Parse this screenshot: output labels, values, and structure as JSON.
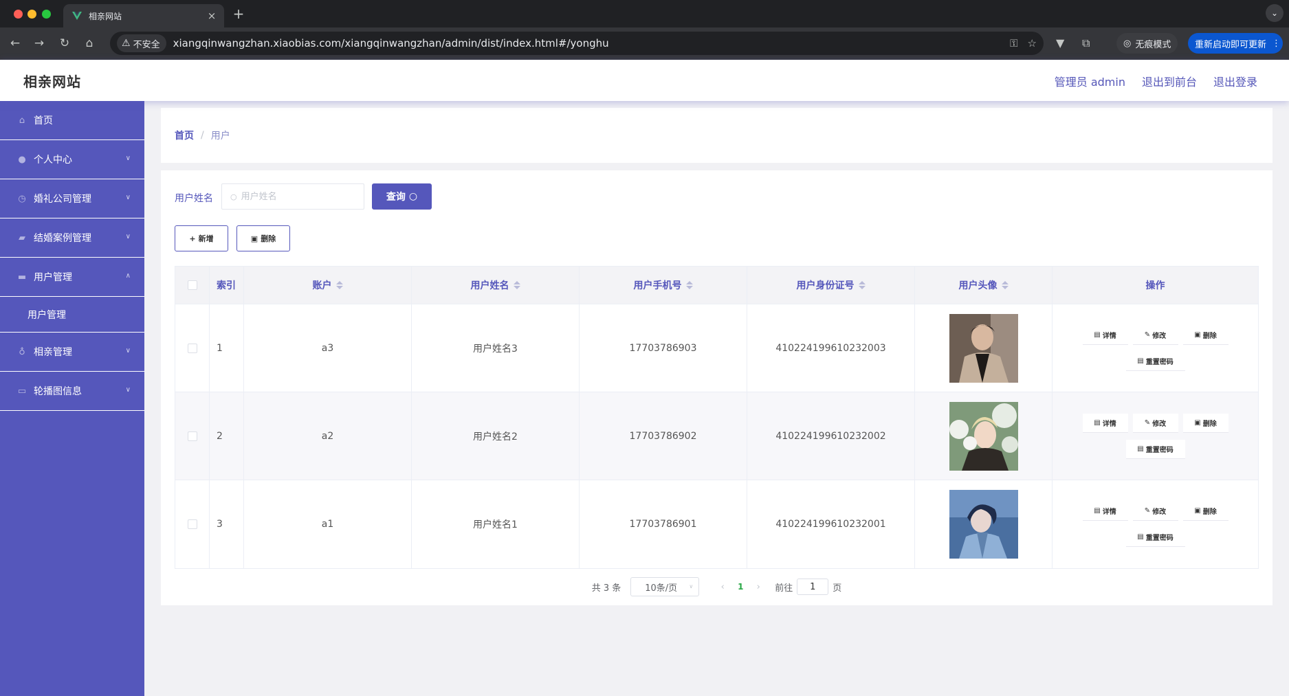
{
  "browser": {
    "tab_title": "相亲网站",
    "tab_close": "×",
    "new_tab": "+",
    "insecure_label": "不安全",
    "url": "xiangqinwangzhan.xiaobias.com/xiangqinwangzhan/admin/dist/index.html#/yonghu",
    "incognito_label": "无痕模式",
    "update_label": "重新启动即可更新"
  },
  "header": {
    "title": "相亲网站",
    "admin_label": "管理员 admin",
    "frontend_link": "退出到前台",
    "logout_link": "退出登录"
  },
  "sidebar": {
    "items": [
      {
        "label": "首页",
        "icon": "home-icon"
      },
      {
        "label": "个人中心",
        "icon": "user-icon"
      },
      {
        "label": "婚礼公司管理",
        "icon": "clock-icon"
      },
      {
        "label": "结婚案例管理",
        "icon": "camera-icon"
      },
      {
        "label": "用户管理",
        "icon": "monitor-icon"
      },
      {
        "label": "用户管理",
        "icon": ""
      },
      {
        "label": "相亲管理",
        "icon": "mic-icon"
      },
      {
        "label": "轮播图信息",
        "icon": "chat-icon"
      }
    ]
  },
  "breadcrumb": {
    "home": "首页",
    "separator": "/",
    "current": "用户"
  },
  "search": {
    "label": "用户姓名",
    "placeholder": "用户姓名",
    "value": "",
    "query_label": "查询"
  },
  "actions": {
    "add_label": "新增",
    "delete_label": "删除"
  },
  "table": {
    "columns": [
      "索引",
      "账户",
      "用户姓名",
      "用户手机号",
      "用户身份证号",
      "用户头像",
      "操作"
    ],
    "rows": [
      {
        "index": "1",
        "account": "a3",
        "name": "用户姓名3",
        "phone": "17703786903",
        "id_card": "410224199610232003"
      },
      {
        "index": "2",
        "account": "a2",
        "name": "用户姓名2",
        "phone": "17703786902",
        "id_card": "410224199610232002"
      },
      {
        "index": "3",
        "account": "a1",
        "name": "用户姓名1",
        "phone": "17703786901",
        "id_card": "410224199610232001"
      }
    ],
    "op_labels": {
      "detail": "详情",
      "edit": "修改",
      "delete": "删除",
      "reset_password": "重置密码"
    }
  },
  "pagination": {
    "total_text": "共 3 条",
    "page_size": "10条/页",
    "current_page": "1",
    "goto_label": "前往",
    "goto_value": "1",
    "page_suffix": "页"
  },
  "colors": {
    "accent": "#5557bb",
    "page_bg": "#f1f1f4",
    "chrome_dark": "#202124"
  }
}
